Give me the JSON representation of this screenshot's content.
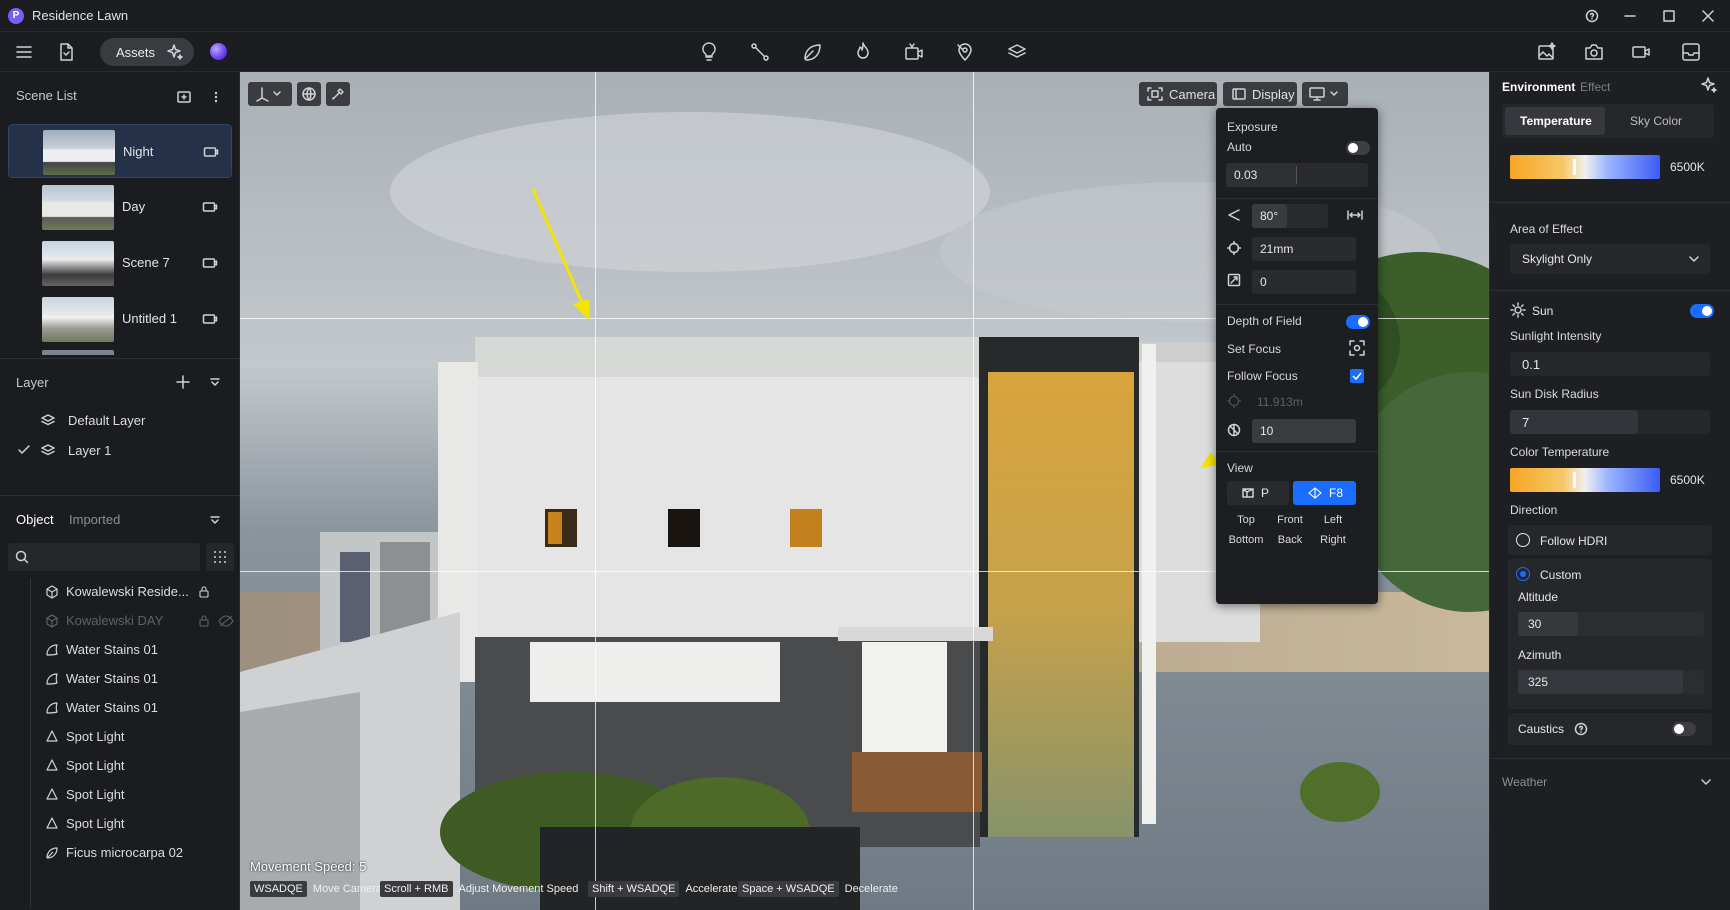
{
  "window": {
    "title": "Residence Lawn",
    "logo_letter": "P"
  },
  "toolbar": {
    "assets_label": "Assets",
    "icons": [
      "menu-icon",
      "import-file-icon",
      "sparkle-icon",
      "lightbulb-icon",
      "path-tool-icon",
      "leaf-icon",
      "fire-icon",
      "camera-animation-icon",
      "pin-marker-icon",
      "layers-icon",
      "image-export-icon",
      "screenshot-camera-icon",
      "video-icon",
      "inbox-icon"
    ]
  },
  "left": {
    "scene_list_label": "Scene List",
    "scenes": [
      {
        "name": "Night",
        "selected": true
      },
      {
        "name": "Day"
      },
      {
        "name": "Scene 7"
      },
      {
        "name": "Untitled 1"
      }
    ],
    "layer_label": "Layer",
    "layers": [
      {
        "name": "Default Layer",
        "checked": false
      },
      {
        "name": "Layer 1",
        "checked": true
      }
    ],
    "object_tab": "Object",
    "imported_tab": "Imported",
    "objects": [
      {
        "name": "Kowalewski Reside...",
        "icon": "cube-icon",
        "locked": true,
        "dim": false
      },
      {
        "name": "Kowalewski DAY",
        "icon": "cube-icon",
        "locked": true,
        "dim": true
      },
      {
        "name": "Water Stains 01",
        "icon": "decal-icon"
      },
      {
        "name": "Water Stains 01",
        "icon": "decal-icon"
      },
      {
        "name": "Water Stains 01",
        "icon": "decal-icon"
      },
      {
        "name": "Spot Light",
        "icon": "spotlight-icon"
      },
      {
        "name": "Spot Light",
        "icon": "spotlight-icon"
      },
      {
        "name": "Spot Light",
        "icon": "spotlight-icon"
      },
      {
        "name": "Spot Light",
        "icon": "spotlight-icon"
      },
      {
        "name": "Ficus microcarpa 02",
        "icon": "plant-icon"
      }
    ]
  },
  "viewport": {
    "camera_label": "Camera",
    "display_label": "Display",
    "movement_speed": "Movement Speed: 5",
    "hints": [
      {
        "key": "WSADQE",
        "text": "Move Camera"
      },
      {
        "key": "Scroll + RMB",
        "text": "Adjust Movement Speed"
      },
      {
        "key": "Shift + WSADQE",
        "text": "Accelerate"
      },
      {
        "key": "Space + WSADQE",
        "text": "Decelerate"
      }
    ]
  },
  "camera_popup": {
    "exposure_label": "Exposure",
    "auto_label": "Auto",
    "auto_on": false,
    "exposure_value": "0.03",
    "fov_value": "80°",
    "focal_length": "21mm",
    "roll_value": "0",
    "dof_label": "Depth of Field",
    "dof_on": true,
    "set_focus_label": "Set Focus",
    "follow_focus_label": "Follow Focus",
    "follow_focus_checked": true,
    "focus_distance": "11.913m",
    "aperture_value": "10",
    "view_label": "View",
    "view_p": "P",
    "view_f8": "F8",
    "views": [
      "Top",
      "Front",
      "Left",
      "Bottom",
      "Back",
      "Right"
    ]
  },
  "right": {
    "tabs": [
      "Environment",
      "Effect"
    ],
    "active_tab": "Environment",
    "subtabs": [
      "Temperature",
      "Sky Color"
    ],
    "active_subtab": "Temperature",
    "temperature_value": "6500K",
    "area_label": "Area of Effect",
    "area_value": "Skylight Only",
    "sun_label": "Sun",
    "sun_on": true,
    "sunlight_intensity_label": "Sunlight Intensity",
    "sunlight_intensity": "0.1",
    "sun_disk_label": "Sun Disk Radius",
    "sun_disk": "7",
    "color_temp_label": "Color Temperature",
    "color_temp_value": "6500K",
    "direction_label": "Direction",
    "follow_hdri_label": "Follow HDRI",
    "custom_label": "Custom",
    "altitude_label": "Altitude",
    "altitude": "30",
    "azimuth_label": "Azimuth",
    "azimuth": "325",
    "caustics_label": "Caustics",
    "caustics_on": false,
    "weather_label": "Weather",
    "accent": "#1a6dff"
  }
}
